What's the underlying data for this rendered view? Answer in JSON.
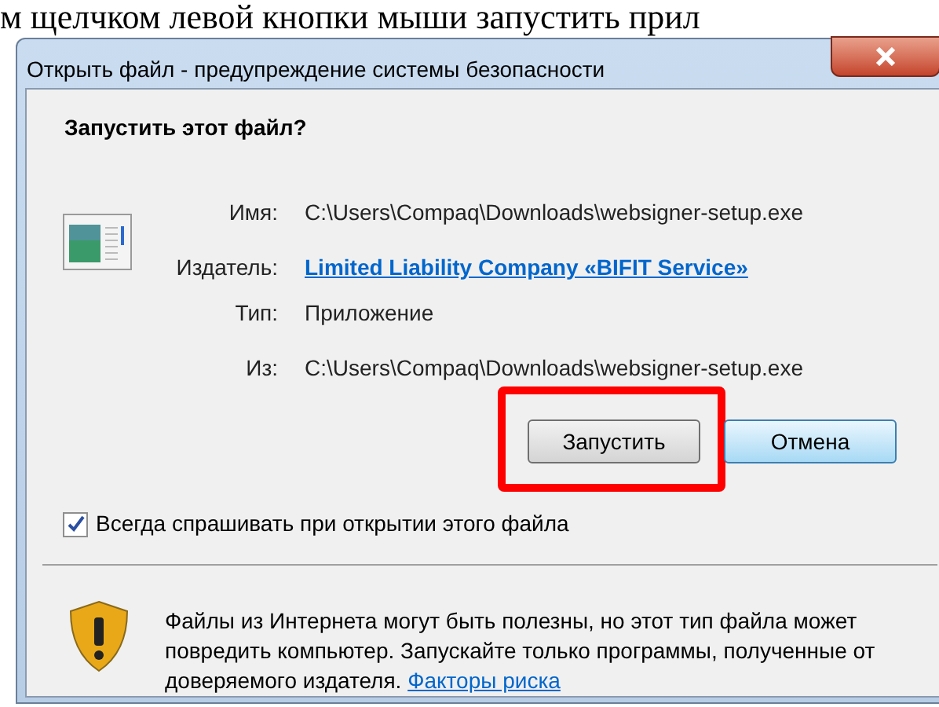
{
  "document_text": "м щелчком левой кнопки мыши запустить прил",
  "window": {
    "title": "Открыть файл - предупреждение системы безопасности"
  },
  "heading": "Запустить этот файл?",
  "fields": [
    {
      "kind": "text",
      "label": "Имя:",
      "value": "C:\\Users\\Compaq\\Downloads\\websigner-setup.exe"
    },
    {
      "kind": "link",
      "label": "Издатель:",
      "value": "Limited Liability Company «BIFIT Service»"
    },
    {
      "kind": "text",
      "label": "Тип:",
      "value": "Приложение"
    },
    {
      "kind": "text",
      "label": "Из:",
      "value": "C:\\Users\\Compaq\\Downloads\\websigner-setup.exe"
    }
  ],
  "buttons": [
    {
      "label": "Запустить",
      "highlighted": true
    },
    {
      "label": "Отмена",
      "highlighted": false
    }
  ],
  "always_ask": {
    "label": "Всегда спрашивать при открытии этого файла",
    "checked": true
  },
  "warning": {
    "text": "Файлы из Интернета могут быть полезны, но этот тип файла может повредить компьютер. Запускайте только программы, полученные от доверяемого издателя.",
    "link": "Факторы риска"
  }
}
